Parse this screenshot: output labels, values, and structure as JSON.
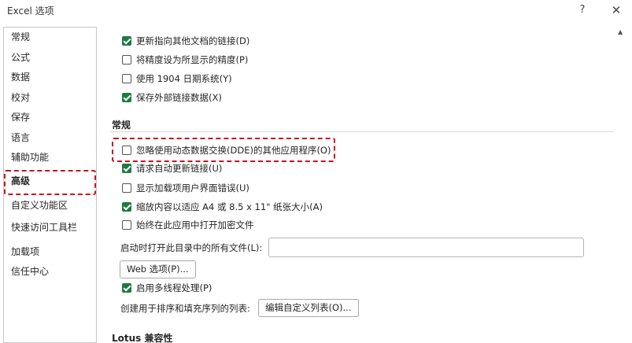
{
  "window": {
    "title": "Excel 选项",
    "help": "?",
    "close": "✕"
  },
  "sidebar": {
    "items": [
      {
        "label": "常规"
      },
      {
        "label": "公式"
      },
      {
        "label": "数据"
      },
      {
        "label": "校对"
      },
      {
        "label": "保存"
      },
      {
        "label": "语言"
      },
      {
        "label": "辅助功能"
      },
      {
        "label": "高级"
      },
      {
        "label": "自定义功能区"
      },
      {
        "label": "快速访问工具栏"
      },
      {
        "label": "加载项"
      },
      {
        "label": "信任中心"
      }
    ],
    "selected": "高级"
  },
  "options_top": [
    {
      "label": "更新指向其他文档的链接(D)",
      "checked": true
    },
    {
      "label": "将精度设为所显示的精度(P)",
      "checked": false
    },
    {
      "label": "使用 1904 日期系统(Y)",
      "checked": false
    },
    {
      "label": "保存外部链接数据(X)",
      "checked": true
    }
  ],
  "general": {
    "heading": "常规",
    "options": [
      {
        "label": "忽略使用动态数据交换(DDE)的其他应用程序(O)",
        "checked": false
      },
      {
        "label": "请求自动更新链接(U)",
        "checked": true
      },
      {
        "label": "显示加载项用户界面错误(U)",
        "checked": false
      },
      {
        "label": "缩放内容以适应 A4 或 8.5 x 11\" 纸张大小(A)",
        "checked": true
      },
      {
        "label": "始终在此应用中打开加密文件",
        "checked": false
      }
    ],
    "startup_label": "启动时打开此目录中的所有文件(L):",
    "startup_value": "",
    "web_options_button": "Web 选项(P)...",
    "multithread": {
      "label": "启用多线程处理(P)",
      "checked": true
    },
    "sort_lists_label": "创建用于排序和填充序列的列表:",
    "edit_lists_button": "编辑自定义列表(O)..."
  },
  "lotus": {
    "heading": "Lotus 兼容性"
  },
  "accent_color": "#1f7a3f",
  "highlight_color": "#d0101c"
}
